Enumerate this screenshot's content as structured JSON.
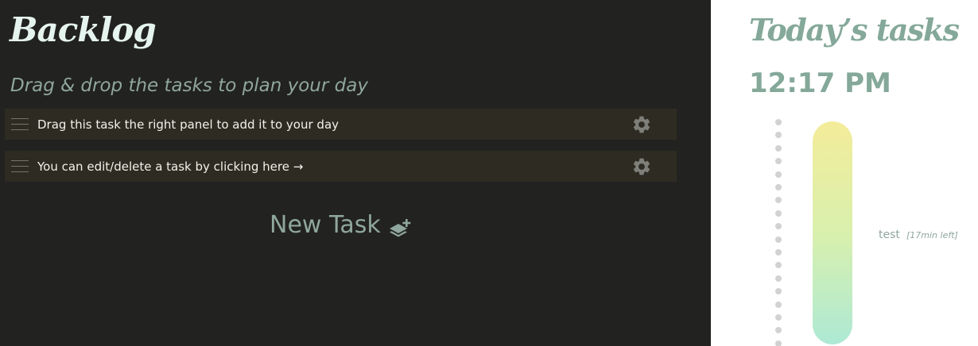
{
  "backlog": {
    "title": "Backlog",
    "subtitle": "Drag & drop the tasks to plan your day",
    "tasks": [
      {
        "label": "Drag this task the right panel to add it to your day",
        "drag_icon": "drag-handle-icon",
        "settings_icon": "gear-icon"
      },
      {
        "label": "You can edit/delete a task by clicking here →",
        "drag_icon": "drag-handle-icon",
        "settings_icon": "gear-icon"
      }
    ],
    "new_task": {
      "label": "New Task",
      "icon": "layers-plus-icon"
    }
  },
  "today": {
    "title": "Today’s tasks",
    "clock": "12:17 PM",
    "scheduled": [
      {
        "name": "test",
        "remaining": "[17min left]"
      }
    ]
  },
  "colors": {
    "backlog_background": "#222220",
    "task_background": "#2e2c22",
    "accent_green": "#84a899",
    "task_bar_top": "#f3ec9a",
    "task_bar_bottom": "#ade9d5"
  }
}
